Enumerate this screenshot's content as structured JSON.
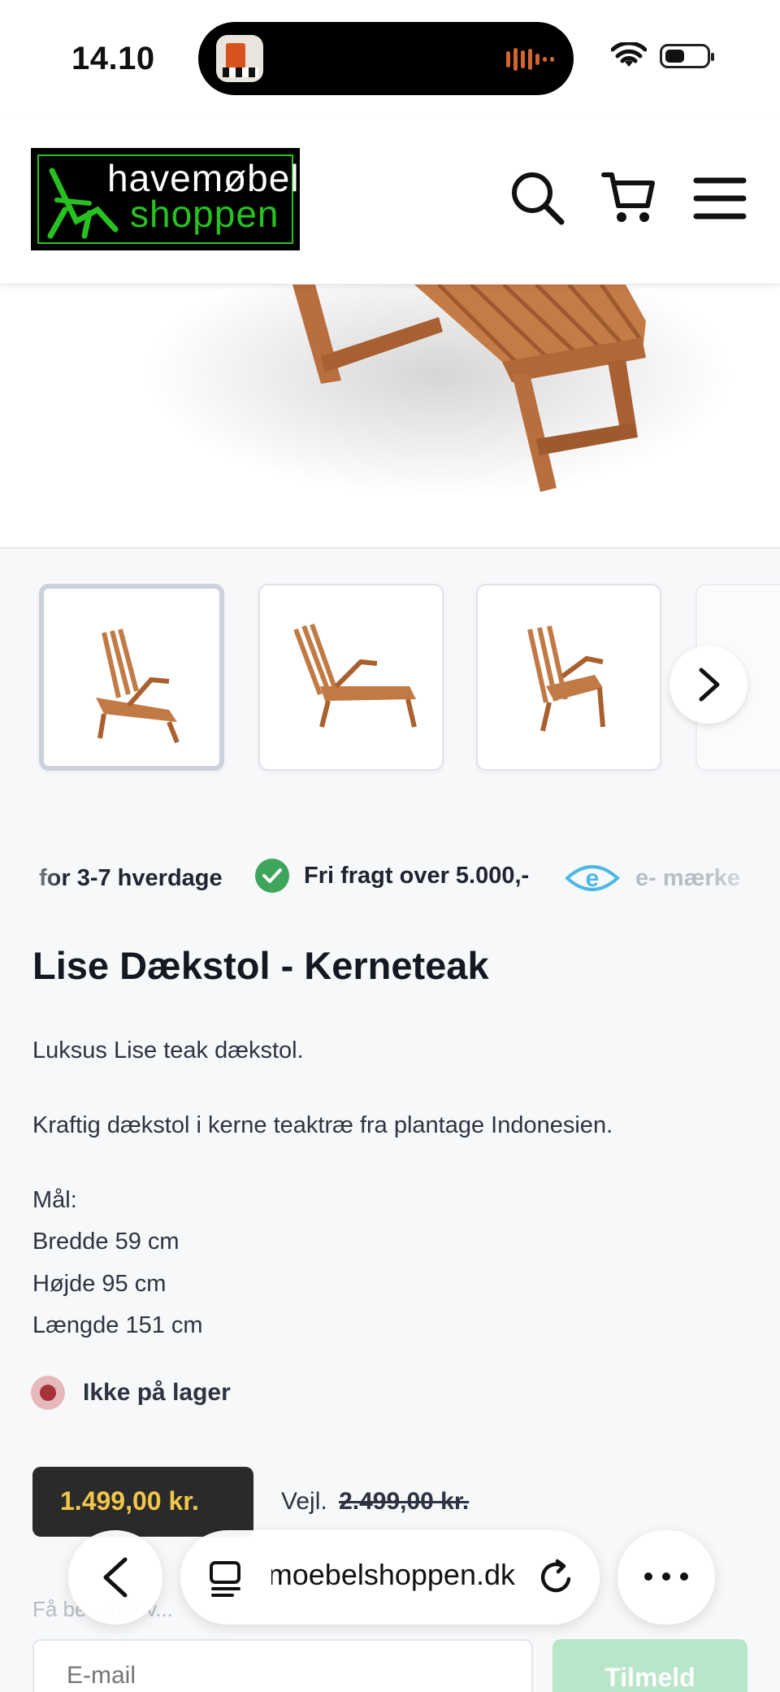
{
  "status_bar": {
    "time": "14.10",
    "battery_level": 0.45
  },
  "header": {
    "logo_line1": "havemøbel",
    "logo_line2": "shoppen",
    "logo_accent_color": "#27c221",
    "icons": [
      "search-icon",
      "cart-icon",
      "menu-icon"
    ]
  },
  "usp_strip": {
    "delivery": "for 3-7 hverdage",
    "free_shipping": "Fri fragt over 5.000,-",
    "emaerke": "e-  mærke"
  },
  "product": {
    "title": "Lise Dækstol - Kerneteak",
    "description": [
      "Luksus Lise teak dækstol.",
      "Kraftig dækstol i kerne teaktræ fra plantage Indonesien."
    ],
    "dimensions_heading": "Mål:",
    "dimensions": [
      "Bredde 59 cm",
      "Højde 95 cm",
      "Længde 151 cm"
    ],
    "stock_status": "Ikke på lager",
    "price": "1.499,00 kr.",
    "rrp_label": "Vejl.",
    "rrp_price": "2.499,00 kr.",
    "price_color": "#f2c64a"
  },
  "notify": {
    "label": "Få be... når v...",
    "email_placeholder": "E-mail",
    "subscribe_label": "Tilmeld"
  },
  "browser_bar": {
    "url": "havemoebelshoppen.dk"
  }
}
